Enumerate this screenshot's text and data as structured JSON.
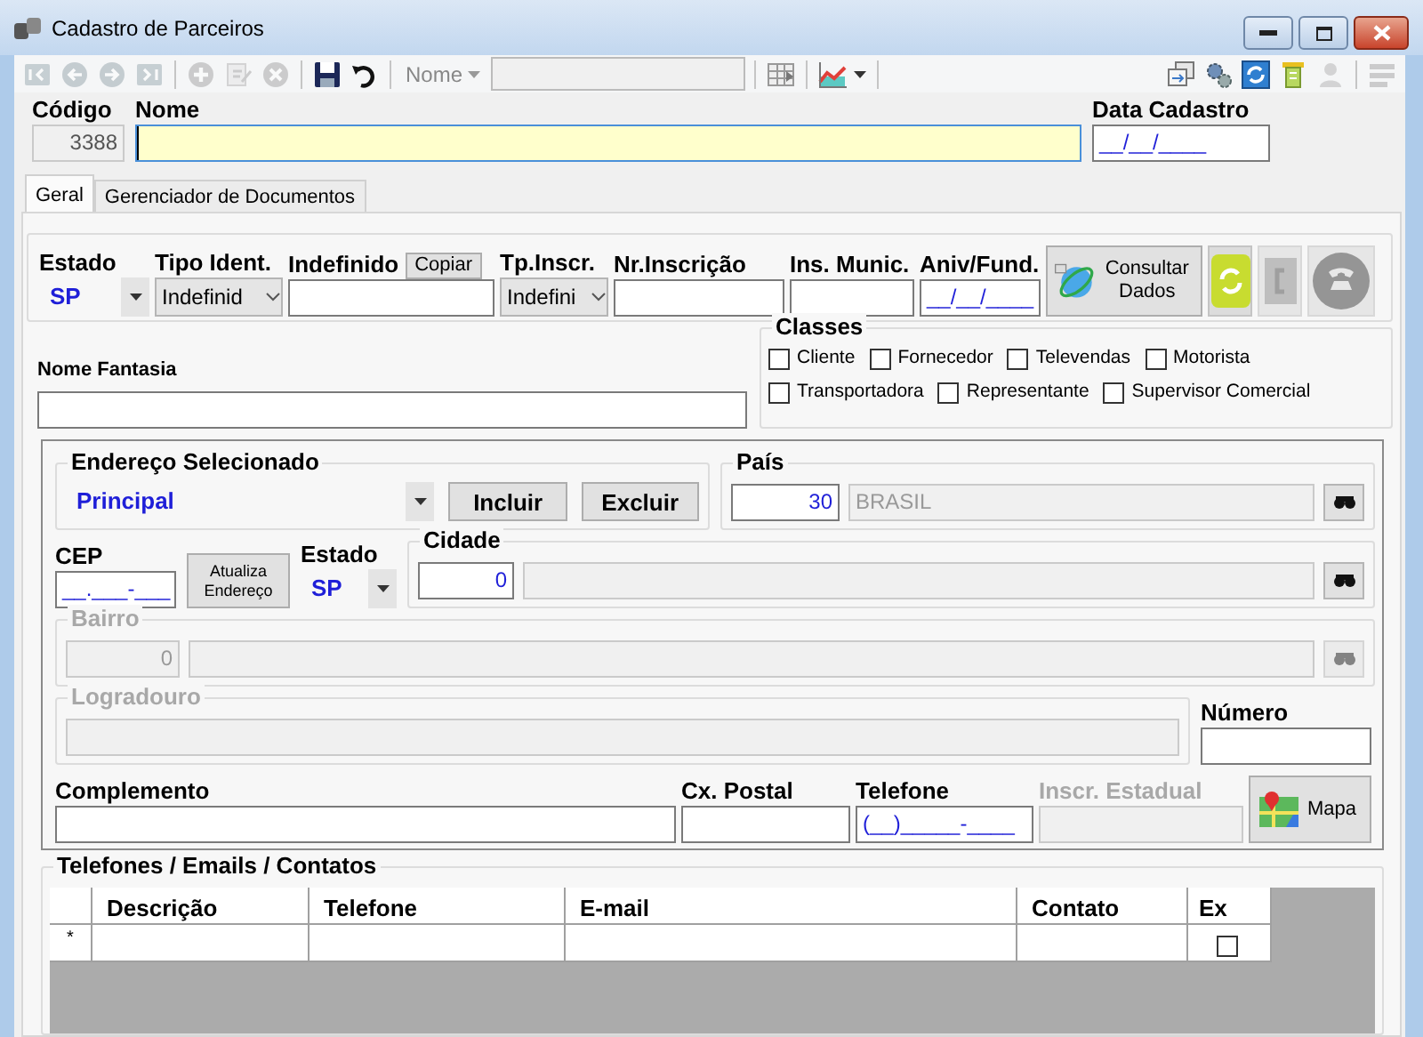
{
  "window": {
    "title": "Cadastro de Parceiros"
  },
  "toolbar": {
    "items": [
      {
        "kind": "first",
        "disabled": true
      },
      {
        "kind": "prev",
        "disabled": true
      },
      {
        "kind": "next",
        "disabled": true
      },
      {
        "kind": "last",
        "disabled": true
      },
      {
        "kind": "separator"
      },
      {
        "kind": "add",
        "disabled": true
      },
      {
        "kind": "edit",
        "disabled": true
      },
      {
        "kind": "delete",
        "disabled": true
      },
      {
        "kind": "separator"
      },
      {
        "kind": "save",
        "disabled": false
      },
      {
        "kind": "undo",
        "disabled": false
      },
      {
        "kind": "separator"
      },
      {
        "kind": "search_by",
        "label": "Nome"
      },
      {
        "kind": "search_field"
      },
      {
        "kind": "separator"
      },
      {
        "kind": "grid",
        "disabled": false
      },
      {
        "kind": "separator"
      },
      {
        "kind": "chart",
        "disabled": false
      },
      {
        "kind": "separator"
      }
    ],
    "right_items": [
      {
        "kind": "windows",
        "disabled": false
      },
      {
        "kind": "gears",
        "disabled": false
      },
      {
        "kind": "refresh",
        "disabled": false
      },
      {
        "kind": "filter",
        "disabled": false
      },
      {
        "kind": "user",
        "disabled": true
      },
      {
        "kind": "separator"
      },
      {
        "kind": "menu",
        "disabled": true
      }
    ]
  },
  "header": {
    "codigo": {
      "label": "Código",
      "value": "3388"
    },
    "nome": {
      "label": "Nome",
      "focused": true
    },
    "data_cadastro": {
      "label": "Data Cadastro",
      "value": "__/__/____"
    }
  },
  "tabs": [
    {
      "label": "Geral",
      "selected": true
    },
    {
      "label": "Gerenciador de Documentos",
      "selected": false
    }
  ],
  "geral": {
    "estado": {
      "label": "Estado",
      "value": "SP"
    },
    "tipo_ident": {
      "label": "Tipo Ident.",
      "value": "Indefinid"
    },
    "indefinido": {
      "label": "Indefinido",
      "button": "Copiar"
    },
    "tp_inscr": {
      "label": "Tp.Inscr.",
      "value": "Indefini"
    },
    "nr_inscricao": {
      "label": "Nr.Inscrição"
    },
    "ins_munic": {
      "label": "Ins. Munic."
    },
    "aniv_fund": {
      "label": "Aniv/Fund.",
      "value": "__/__/____"
    },
    "consultar": {
      "label": "Consultar Dados"
    },
    "action_buttons": [
      {
        "kind": "sync",
        "disabled": false
      },
      {
        "kind": "contacts",
        "disabled": true
      },
      {
        "kind": "phone",
        "disabled": true
      }
    ],
    "nome_fantasia": {
      "label": "Nome Fantasia"
    },
    "classes": {
      "title": "Classes",
      "items": [
        {
          "label": "Cliente",
          "checked": false
        },
        {
          "label": "Fornecedor",
          "checked": false
        },
        {
          "label": "Televendas",
          "checked": false
        },
        {
          "label": "Motorista",
          "checked": false
        },
        {
          "label": "Transportadora",
          "checked": false
        },
        {
          "label": "Representante",
          "checked": false
        },
        {
          "label": "Supervisor Comercial",
          "checked": false
        }
      ]
    }
  },
  "endereco": {
    "selecionado": {
      "label": "Endereço Selecionado",
      "value": "Principal",
      "buttons": [
        "Incluir",
        "Excluir"
      ]
    },
    "pais": {
      "label": "País",
      "code": "30",
      "name": "BRASIL"
    },
    "cep": {
      "label": "CEP",
      "value": "__.___-___"
    },
    "atualiza": {
      "label": "Atualiza Endereço"
    },
    "estado": {
      "label": "Estado",
      "value": "SP"
    },
    "cidade": {
      "label": "Cidade",
      "code": "0",
      "disabled": false
    },
    "bairro": {
      "label": "Bairro",
      "code": "0",
      "disabled": true
    },
    "logradouro": {
      "label": "Logradouro",
      "disabled": true
    },
    "numero": {
      "label": "Número"
    },
    "complemento": {
      "label": "Complemento"
    },
    "cx_postal": {
      "label": "Cx. Postal"
    },
    "telefone": {
      "label": "Telefone",
      "value": "(__)_____-____"
    },
    "inscr_estadual": {
      "label": "Inscr. Estadual",
      "disabled": true
    },
    "mapa": {
      "label": "Mapa"
    }
  },
  "contatos": {
    "title": "Telefones / Emails / Contatos",
    "columns": [
      "Descrição",
      "Telefone",
      "E-mail",
      "Contato",
      "Ex"
    ],
    "new_row": {
      "marker": "*",
      "ex_checked": false
    }
  }
}
